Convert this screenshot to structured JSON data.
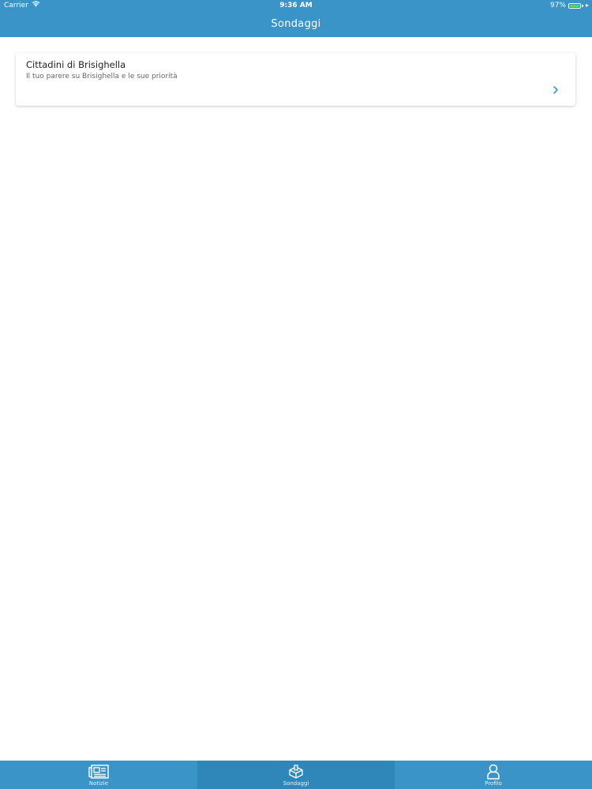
{
  "status_bar": {
    "carrier": "Carrier",
    "time": "9:36 AM",
    "battery_percent": "97%",
    "battery_level": 0.97,
    "battery_fill_color": "#4cd964"
  },
  "nav": {
    "title": "Sondaggi"
  },
  "surveys": [
    {
      "title": "Cittadini di Brisighella",
      "subtitle": "Il tuo parere su Brisighella e le sue priorità",
      "icon": "chevron-right-icon"
    }
  ],
  "tabs": [
    {
      "label": "Notizie",
      "icon": "newspaper-icon",
      "active": false
    },
    {
      "label": "Sondaggi",
      "icon": "ballot-box-icon",
      "active": true
    },
    {
      "label": "Profilo",
      "icon": "user-icon",
      "active": false
    }
  ],
  "colors": {
    "primary": "#3a94c7",
    "primary_active": "#2e86b9",
    "background": "#ffffff"
  }
}
